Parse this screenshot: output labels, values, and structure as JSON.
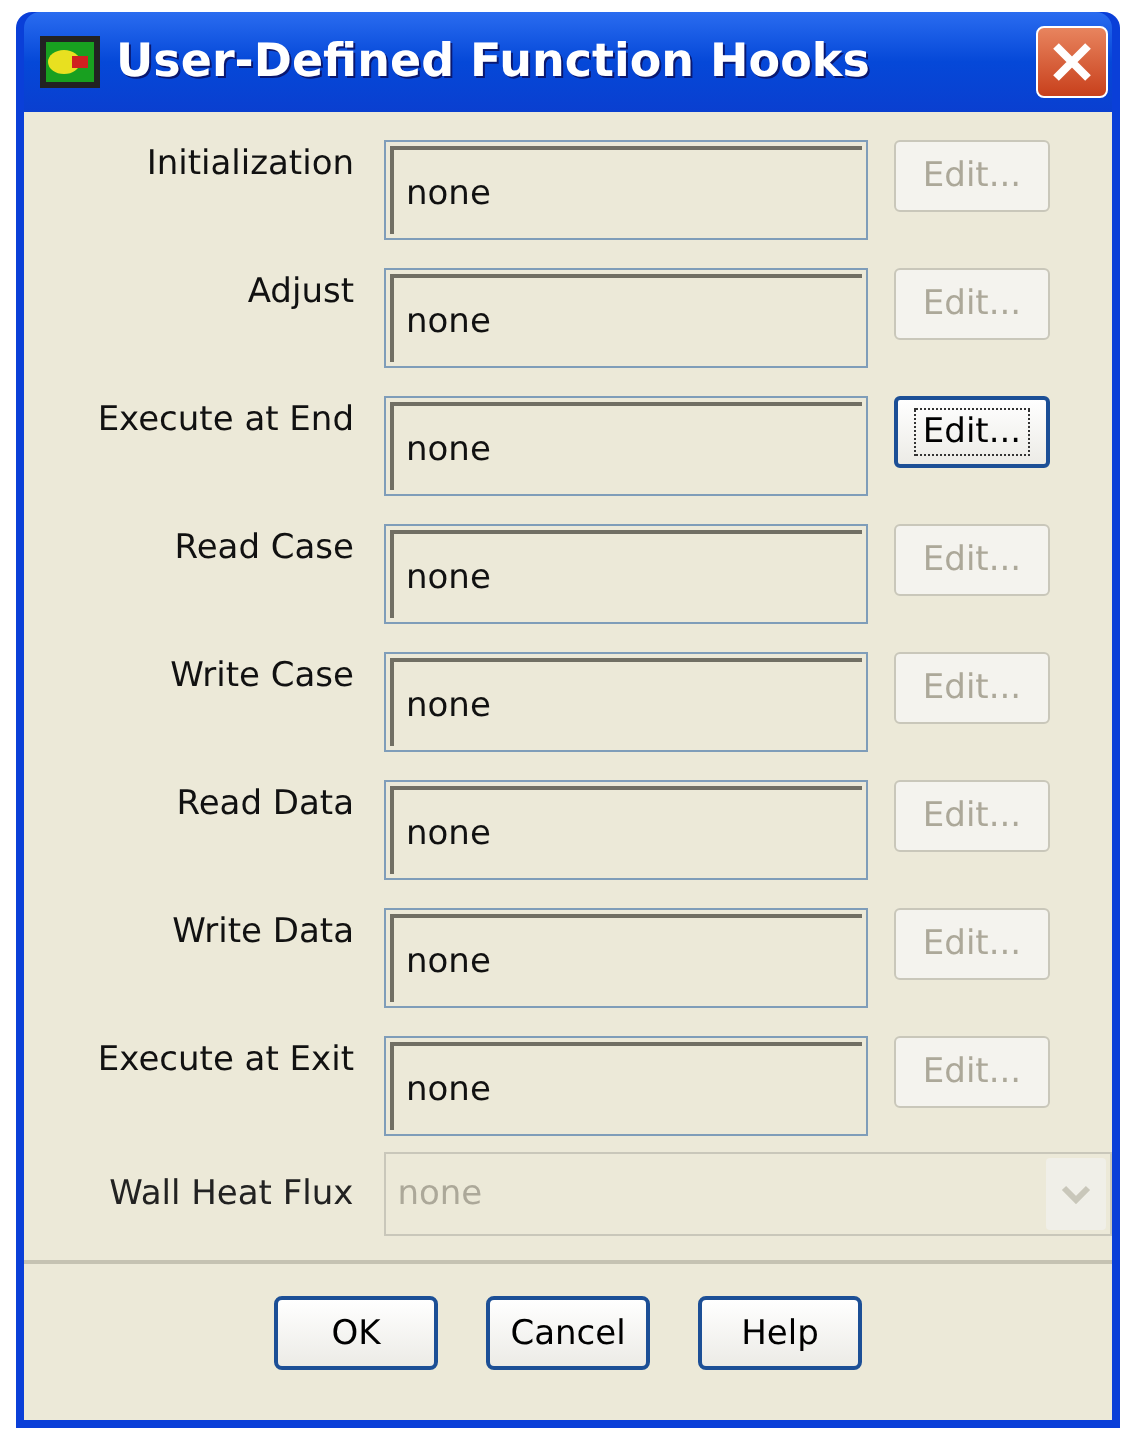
{
  "window": {
    "title": "User-Defined Function Hooks"
  },
  "hooks": [
    {
      "label": "Initialization",
      "value": "none",
      "edit": {
        "label": "Edit...",
        "disabled": true,
        "focused": false
      }
    },
    {
      "label": "Adjust",
      "value": "none",
      "edit": {
        "label": "Edit...",
        "disabled": true,
        "focused": false
      }
    },
    {
      "label": "Execute at End",
      "value": "none",
      "edit": {
        "label": "Edit...",
        "disabled": false,
        "focused": true
      }
    },
    {
      "label": "Read Case",
      "value": "none",
      "edit": {
        "label": "Edit...",
        "disabled": true,
        "focused": false
      }
    },
    {
      "label": "Write Case",
      "value": "none",
      "edit": {
        "label": "Edit...",
        "disabled": true,
        "focused": false
      }
    },
    {
      "label": "Read Data",
      "value": "none",
      "edit": {
        "label": "Edit...",
        "disabled": true,
        "focused": false
      }
    },
    {
      "label": "Write Data",
      "value": "none",
      "edit": {
        "label": "Edit...",
        "disabled": true,
        "focused": false
      }
    },
    {
      "label": "Execute at Exit",
      "value": "none",
      "edit": {
        "label": "Edit...",
        "disabled": true,
        "focused": false
      }
    }
  ],
  "wall_heat_flux": {
    "label": "Wall Heat Flux",
    "value": "none",
    "disabled": true
  },
  "buttons": [
    "OK",
    "Cancel",
    "Help"
  ]
}
